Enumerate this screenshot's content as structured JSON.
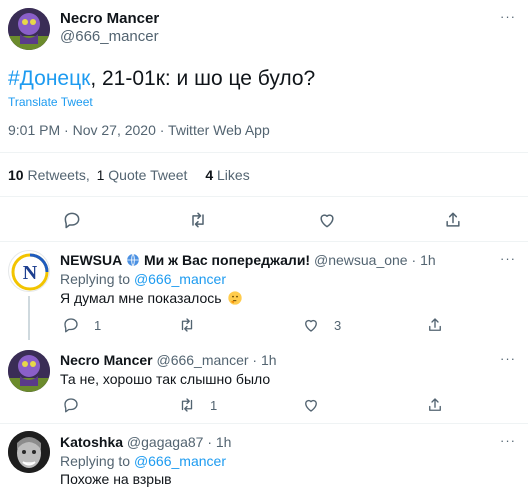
{
  "main_tweet": {
    "author_name": "Necro Mancer",
    "author_handle": "@666_mancer",
    "hashtag": "#Донецк",
    "text_rest": ", 21-01к: и шо це було?",
    "translate": "Translate Tweet",
    "meta": "9:01 PM · Nov 27, 2020 · Twitter Web App",
    "stats": {
      "retweets_count": "10",
      "retweets_label": "Retweets",
      "separator": ",",
      "quotes_count": "1",
      "quotes_label": "Quote Tweet",
      "likes_count": "4",
      "likes_label": "Likes"
    }
  },
  "replies": [
    {
      "name": "NEWSUA",
      "name_suffix": "Ми ж Вас попереджали!",
      "handle": "@newsua_one",
      "dot": "·",
      "time": "1h",
      "replying_to_label": "Replying to",
      "replying_to_handle": "@666_mancer",
      "text": "Я думал мне показалось",
      "reply_count": "1",
      "retweet_count": "",
      "like_count": "3"
    },
    {
      "name": "Necro Mancer",
      "handle": "@666_mancer",
      "dot": "·",
      "time": "1h",
      "text": "Та не, хорошо так слышно было",
      "reply_count": "",
      "retweet_count": "1",
      "like_count": ""
    },
    {
      "name": "Katoshka",
      "handle": "@gagaga87",
      "dot": "·",
      "time": "1h",
      "replying_to_label": "Replying to",
      "replying_to_handle": "@666_mancer",
      "text": "Похоже на взрыв"
    }
  ],
  "more_glyph": "···",
  "colors": {
    "accent": "#1d9bf0",
    "muted": "#536471",
    "divider": "#eff3f4"
  }
}
